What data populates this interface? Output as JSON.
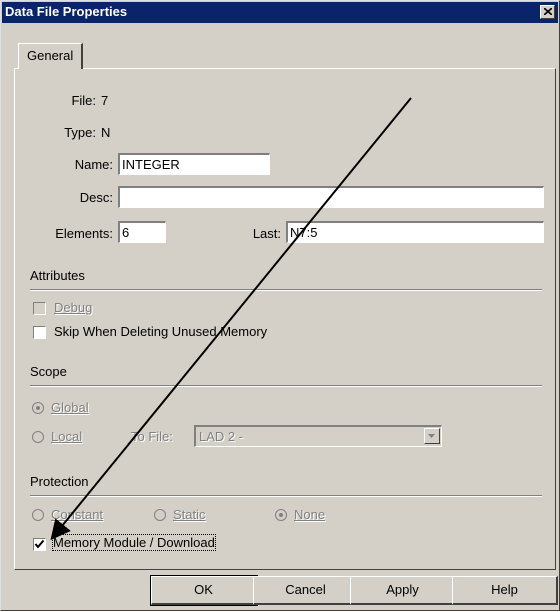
{
  "window": {
    "title": "Data File Properties",
    "close_glyph": "×"
  },
  "tabs": [
    {
      "label": "General"
    }
  ],
  "fields": {
    "file": {
      "label": "File:",
      "value": "7"
    },
    "type": {
      "label": "Type:",
      "value": "N"
    },
    "name": {
      "label": "Name:",
      "value": "INTEGER"
    },
    "desc": {
      "label": "Desc:",
      "value": ""
    },
    "elements": {
      "label": "Elements:",
      "value": "6"
    },
    "last": {
      "label": "Last:",
      "value": "N7:5"
    }
  },
  "attributes": {
    "heading": "Attributes",
    "debug": {
      "label": "Debug",
      "checked": false,
      "enabled": false
    },
    "skip": {
      "label": "Skip When Deleting Unused Memory",
      "checked": false,
      "enabled": true
    }
  },
  "scope": {
    "heading": "Scope",
    "global": {
      "label": "Global",
      "selected": true,
      "enabled": false
    },
    "local": {
      "label": "Local",
      "selected": false,
      "enabled": false
    },
    "to_file_label": "To File:",
    "to_file_value": "LAD 2 -"
  },
  "protection": {
    "heading": "Protection",
    "constant": {
      "label": "Constant",
      "selected": false,
      "enabled": false
    },
    "static": {
      "label": "Static",
      "selected": false,
      "enabled": false
    },
    "none": {
      "label": "None",
      "selected": true,
      "enabled": false
    },
    "memory_module": {
      "label": "Memory Module / Download",
      "checked": true
    }
  },
  "buttons": {
    "ok": "OK",
    "cancel": "Cancel",
    "apply": "Apply",
    "help": "Help"
  },
  "colors": {
    "title_bar": "#0a246a",
    "face": "#d4d0c8"
  }
}
